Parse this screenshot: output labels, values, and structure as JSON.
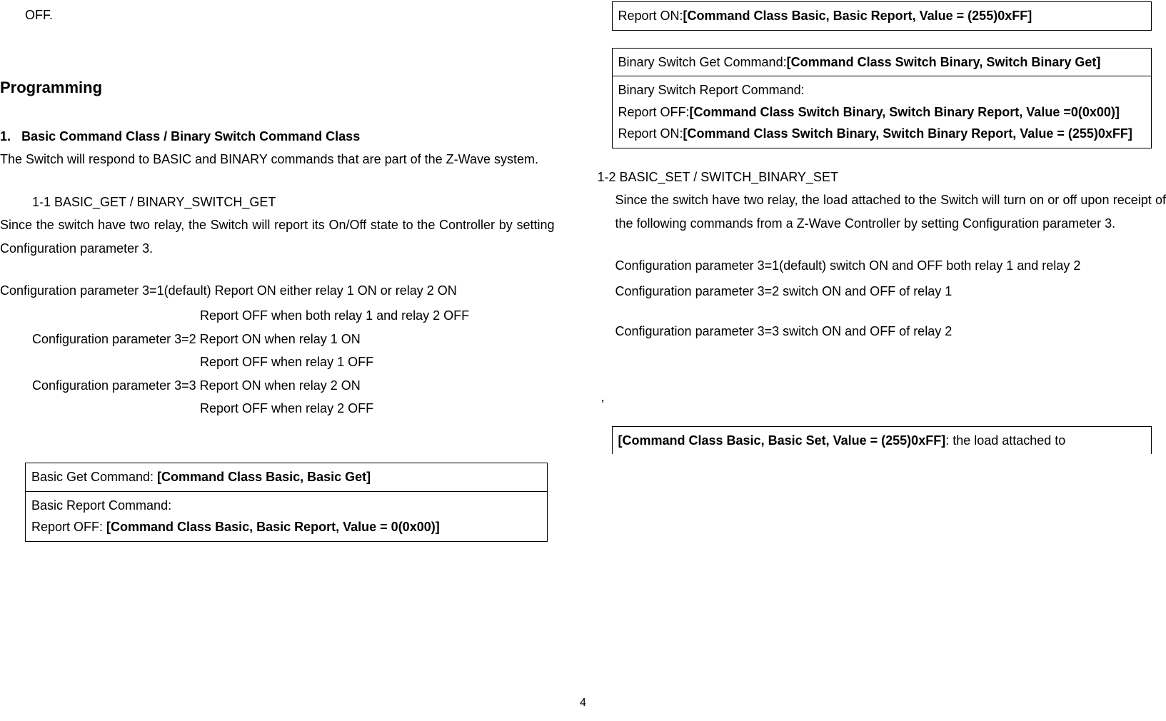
{
  "left": {
    "off": "OFF.",
    "heading": "Programming",
    "sec1_num": "1.",
    "sec1_title": "Basic Command Class / Binary Switch Command Class",
    "sec1_text": "The Switch will respond to BASIC and BINARY commands that are part of the Z-Wave system.",
    "sec11_title": "1-1 BASIC_GET / BINARY_SWITCH_GET",
    "sec11_text": "Since the switch have two relay, the Switch will report its On/Off state to the Controller by setting Configuration parameter 3.",
    "cfg1_a": "Configuration parameter 3=1(default) Report ON either relay 1 ON or relay 2 ON",
    "cfg1_b": "Report OFF when both relay 1 and relay 2 OFF",
    "cfg2_a": "Configuration parameter 3=2 Report ON when relay 1 ON",
    "cfg2_b": "Report OFF when relay 1 OFF",
    "cfg3_a": "Configuration parameter 3=3 Report ON when relay 2 ON",
    "cfg3_b": "Report OFF when relay 2 OFF",
    "tbl1_row1_a": "Basic Get Command: ",
    "tbl1_row1_b": "[Command Class Basic, Basic Get]",
    "tbl1_row2_a": "Basic Report Command:",
    "tbl1_row2_b": "Report OFF: ",
    "tbl1_row2_c": "[Command Class Basic, Basic Report, Value = 0(0x00)]"
  },
  "right": {
    "tbl1_row3_a": "Report ON:",
    "tbl1_row3_b": "[Command Class Basic, Basic Report, Value = (255)0xFF]",
    "tbl2_row1_a": "Binary Switch Get Command:",
    "tbl2_row1_b": "[Command Class Switch Binary, Switch Binary Get]",
    "tbl2_row2_a": "Binary Switch Report Command:",
    "tbl2_row2_b": "Report OFF:",
    "tbl2_row2_c": "[Command Class Switch Binary, Switch Binary Report, Value =0(0x00)]",
    "tbl2_row2_d": "Report ON:",
    "tbl2_row2_e": "[Command Class Switch Binary, Switch Binary Report, Value = (255)0xFF]",
    "sec12_title": "1-2 BASIC_SET / SWITCH_BINARY_SET",
    "sec12_text": "Since the switch have two relay, the load attached to the Switch will turn on or off upon receipt of the following commands from a Z-Wave Controller by setting Configuration parameter 3.",
    "cfg1": "Configuration parameter 3=1(default) switch ON and OFF both relay 1 and relay 2",
    "cfg2": "Configuration parameter 3=2 switch ON and OFF of relay 1",
    "cfg3": "Configuration parameter 3=3 switch ON and OFF of relay 2",
    "comma": ",",
    "tbl3_a": "[Command Class Basic, Basic Set, Value = (255)0xFF]",
    "tbl3_b": ": the load attached to"
  },
  "pagenum": "4"
}
